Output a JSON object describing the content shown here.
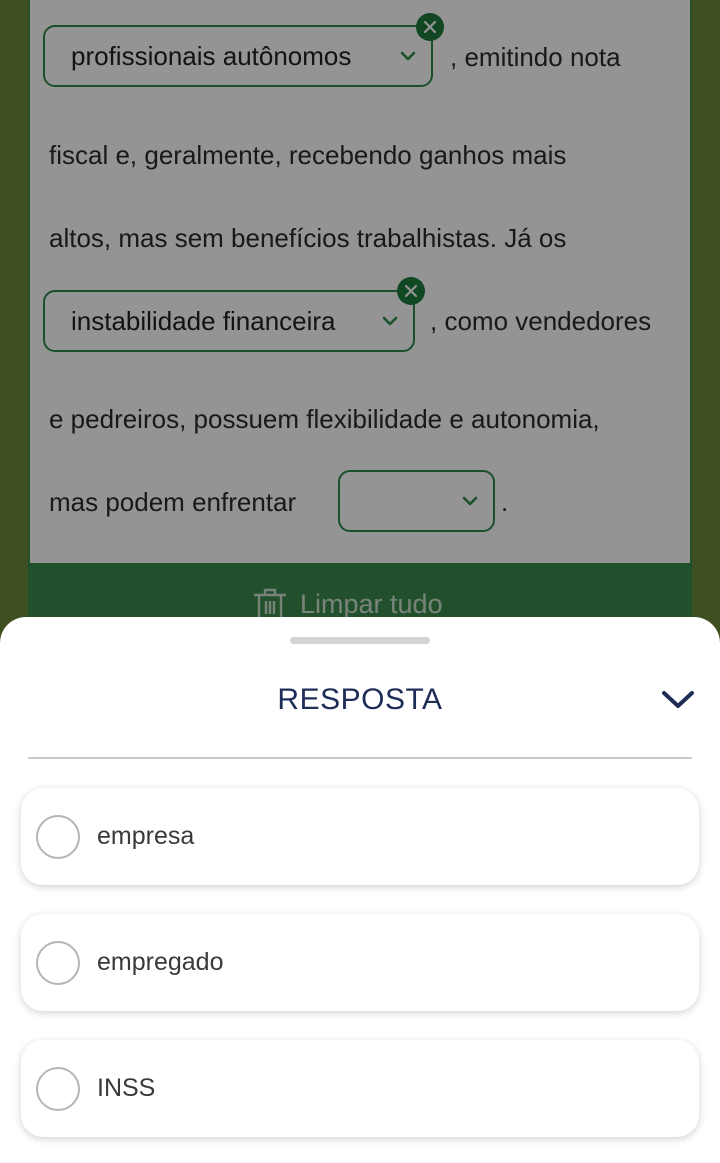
{
  "exercise": {
    "dropdown1": {
      "value": "profissionais autônomos"
    },
    "text1": ", emitindo nota",
    "text2": "fiscal e, geralmente, recebendo ganhos mais",
    "text3": "altos, mas sem benefícios trabalhistas. Já os",
    "dropdown2": {
      "value": "instabilidade financeira"
    },
    "text4": ", como vendedores",
    "text5": "e pedreiros, possuem flexibilidade e autonomia,",
    "text6": "mas podem enfrentar",
    "dropdown3": {
      "value": ""
    },
    "text7": ".",
    "clear_label": "Limpar tudo"
  },
  "sheet": {
    "title": "RESPOSTA",
    "options": [
      {
        "label": "empresa"
      },
      {
        "label": "empregado"
      },
      {
        "label": "INSS"
      }
    ]
  },
  "colors": {
    "accent_green": "#2e8b4a",
    "title_navy": "#1e2c58"
  },
  "icons": [
    "close-icon",
    "chevron-down-icon",
    "trash-icon"
  ]
}
